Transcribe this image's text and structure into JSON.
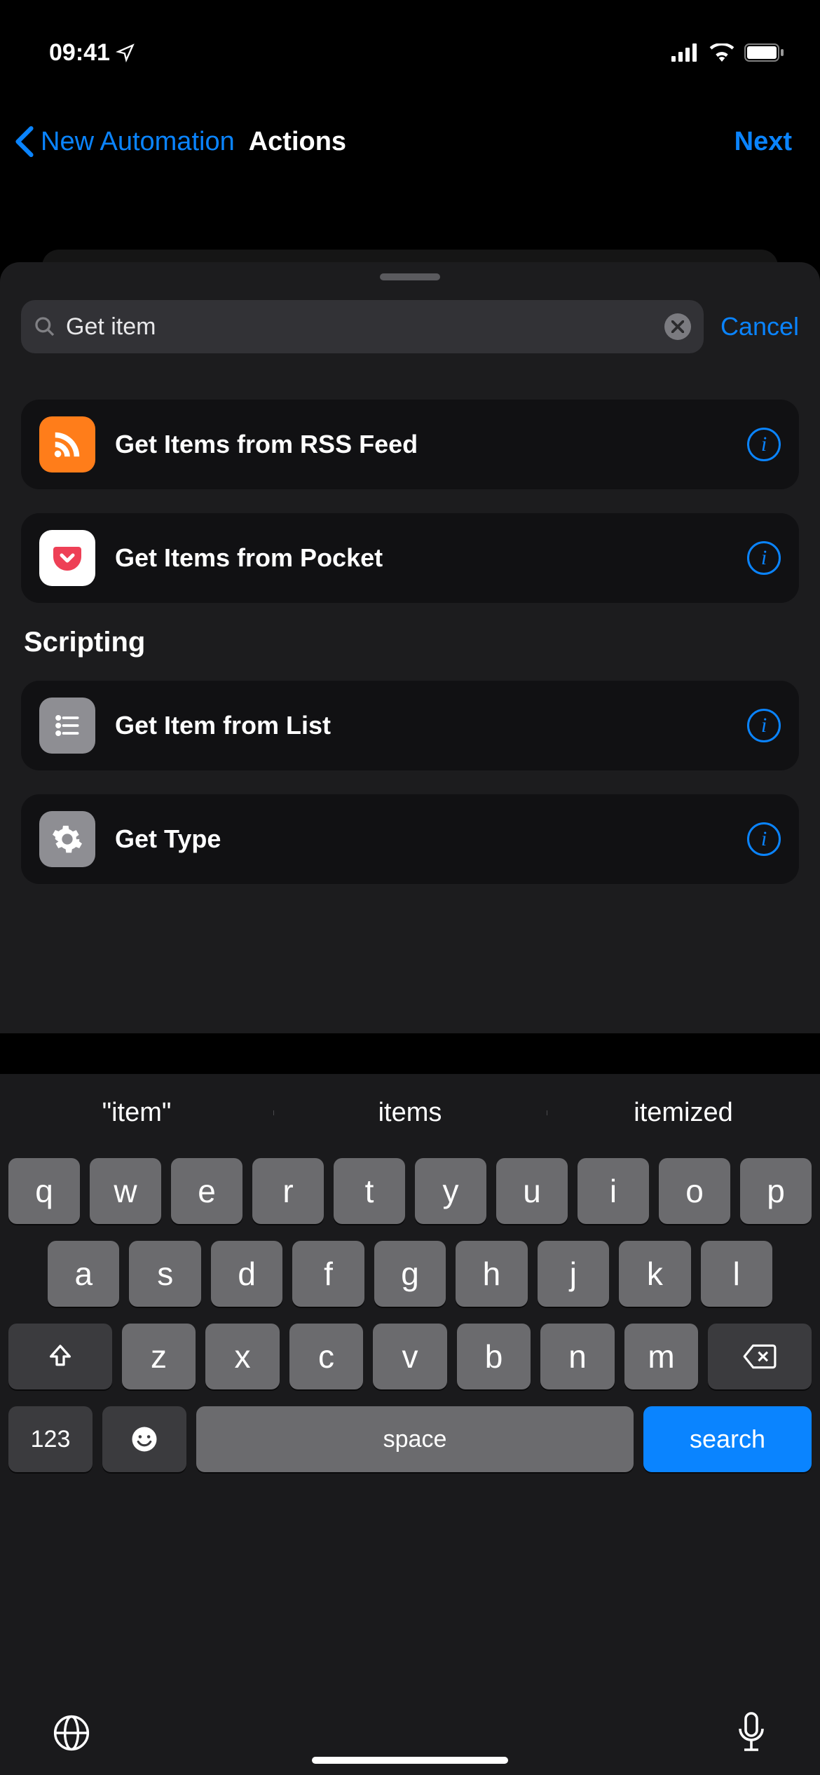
{
  "status": {
    "time": "09:41"
  },
  "nav": {
    "back_label": "New Automation",
    "title": "Actions",
    "next": "Next"
  },
  "search": {
    "value": "Get item",
    "cancel": "Cancel"
  },
  "results_top": [
    {
      "label": "Get Items from RSS Feed",
      "icon": "rss"
    },
    {
      "label": "Get Items from Pocket",
      "icon": "pocket"
    }
  ],
  "section_title": "Scripting",
  "results_scripting": [
    {
      "label": "Get Item from List",
      "icon": "list"
    },
    {
      "label": "Get Type",
      "icon": "gear"
    }
  ],
  "suggestions": [
    "\"item\"",
    "items",
    "itemized"
  ],
  "keyboard": {
    "row1": [
      "q",
      "w",
      "e",
      "r",
      "t",
      "y",
      "u",
      "i",
      "o",
      "p"
    ],
    "row2": [
      "a",
      "s",
      "d",
      "f",
      "g",
      "h",
      "j",
      "k",
      "l"
    ],
    "row3": [
      "z",
      "x",
      "c",
      "v",
      "b",
      "n",
      "m"
    ],
    "numkey": "123",
    "space": "space",
    "search": "search"
  }
}
